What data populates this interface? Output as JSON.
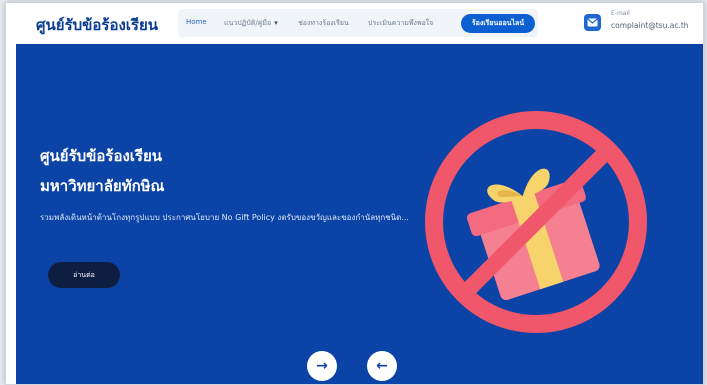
{
  "brand": {
    "name": "ศูนย์รับข้อร้องเรียน"
  },
  "nav": {
    "items": [
      {
        "label": "Home"
      },
      {
        "label": "แนวปฏิบัติ/คู่มือ"
      },
      {
        "label": "ช่องทางร้องเรียน"
      },
      {
        "label": "ประเมินความพึงพอใจ"
      }
    ],
    "cta_label": "ร้องเรียนออนไลน์"
  },
  "contact": {
    "label": "E-mail",
    "value": "complaint@tsu.ac.th"
  },
  "hero": {
    "title_line1": "ศูนย์รับข้อร้องเรียน",
    "title_line2": "มหาวิทยาลัยทักษิณ",
    "description": "รวมพลังเดินหน้าต้านโกงทุกรูปแบบ ประกาศนโยบาย No Gift Policy งดรับของขวัญและของกำนัลทุกชนิด...",
    "button_label": "อ่านต่อ"
  },
  "carousel": {
    "next_symbol": "→",
    "prev_symbol": "←"
  },
  "colors": {
    "hero_bg": "#0b43a6",
    "accent": "#0c5fd1",
    "forbidden_red": "#f0576a",
    "gift_pink": "#f58091",
    "ribbon_yellow": "#f7d46b"
  }
}
